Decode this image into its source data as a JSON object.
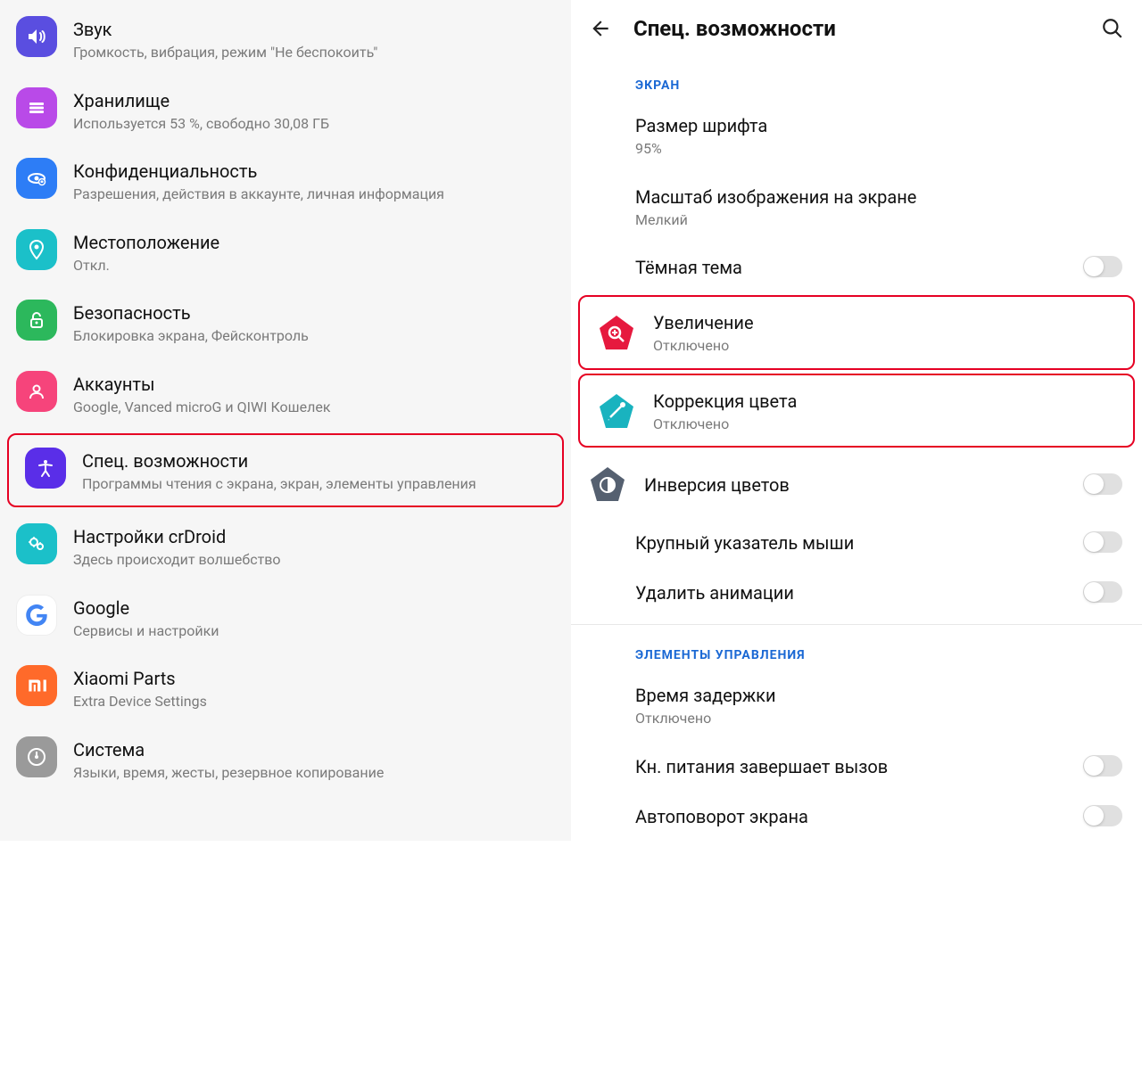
{
  "left": {
    "items": [
      {
        "title": "Звук",
        "sub": "Громкость, вибрация, режим \"Не беспокоить\"",
        "color": "#5a4ee0"
      },
      {
        "title": "Хранилище",
        "sub": "Используется 53 %, свободно 30,08 ГБ",
        "color": "#b94ae8"
      },
      {
        "title": "Конфиденциальность",
        "sub": "Разрешения, действия в аккаунте, личная информация",
        "color": "#2d7df6"
      },
      {
        "title": "Местоположение",
        "sub": "Откл.",
        "color": "#1bc0c9"
      },
      {
        "title": "Безопасность",
        "sub": "Блокировка экрана, Фейсконтроль",
        "color": "#2cb85c"
      },
      {
        "title": "Аккаунты",
        "sub": "Google, Vanced microG и QIWI Кошелек",
        "color": "#f6447b"
      },
      {
        "title": "Спец. возможности",
        "sub": "Программы чтения с экрана, экран, элементы управления",
        "color": "#5a2ee8",
        "highlight": true
      },
      {
        "title": "Настройки crDroid",
        "sub": "Здесь происходит волшебство",
        "color": "#1bc0c9"
      },
      {
        "title": "Google",
        "sub": "Сервисы и настройки",
        "color": "#ffffff"
      },
      {
        "title": "Xiaomi Parts",
        "sub": "Extra Device Settings",
        "color": "#ff6a2a"
      },
      {
        "title": "Система",
        "sub": "Языки, время, жесты, резервное копирование",
        "color": "#9a9a9a"
      }
    ]
  },
  "right": {
    "title": "Спец. возможности",
    "section1": "ЭКРАН",
    "section2": "ЭЛЕМЕНТЫ УПРАВЛЕНИЯ",
    "items1": [
      {
        "title": "Размер шрифта",
        "sub": "95%"
      },
      {
        "title": "Масштаб изображения на экране",
        "sub": "Мелкий"
      },
      {
        "title": "Тёмная тема",
        "toggle": true
      }
    ],
    "items_icon": [
      {
        "title": "Увеличение",
        "sub": "Отключено",
        "color": "#e6193e",
        "highlight": true
      },
      {
        "title": "Коррекция цвета",
        "sub": "Отключено",
        "color": "#19b3bf",
        "highlight": true
      },
      {
        "title": "Инверсия цветов",
        "color": "#556070",
        "toggle": true
      }
    ],
    "items2": [
      {
        "title": "Крупный указатель мыши",
        "toggle": true
      },
      {
        "title": "Удалить анимации",
        "toggle": true
      }
    ],
    "items3": [
      {
        "title": "Время задержки",
        "sub": "Отключено"
      },
      {
        "title": "Кн. питания завершает вызов",
        "toggle": true
      },
      {
        "title": "Автоповорот экрана",
        "toggle": true
      }
    ]
  }
}
